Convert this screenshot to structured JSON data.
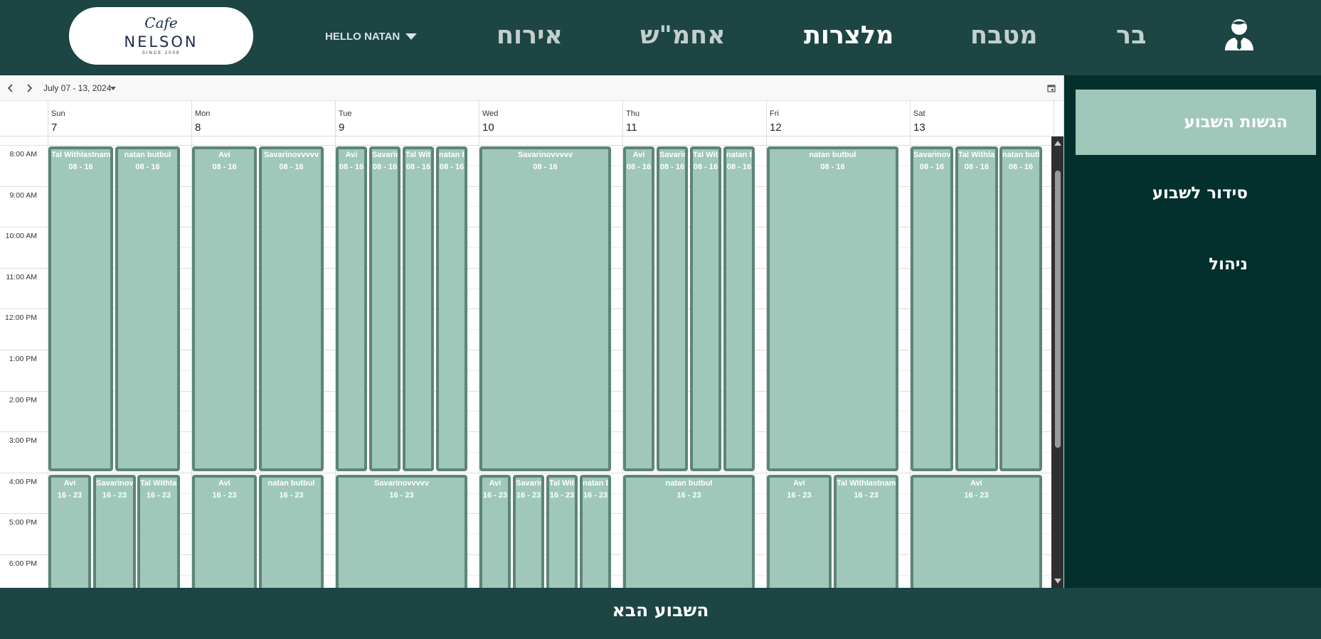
{
  "header": {
    "logo": {
      "script": "Cafe",
      "brand": "NELSON",
      "since": "SINCE 2009"
    },
    "user_greeting": "HELLO NATAN",
    "nav": [
      {
        "label": "אירוח",
        "active": false
      },
      {
        "label": "אחמ\"ש",
        "active": false
      },
      {
        "label": "מלצרות",
        "active": true
      },
      {
        "label": "מטבח",
        "active": false
      },
      {
        "label": "בר",
        "active": false
      }
    ]
  },
  "scheduler": {
    "range_label": "July 07 - 13, 2024",
    "days": [
      {
        "name": "Sun",
        "date": "7"
      },
      {
        "name": "Mon",
        "date": "8"
      },
      {
        "name": "Tue",
        "date": "9"
      },
      {
        "name": "Wed",
        "date": "10"
      },
      {
        "name": "Thu",
        "date": "11"
      },
      {
        "name": "Fri",
        "date": "12"
      },
      {
        "name": "Sat",
        "date": "13"
      }
    ],
    "time_labels": [
      "8:00 AM",
      "9:00 AM",
      "10:00 AM",
      "11:00 AM",
      "12:00 PM",
      "1:00 PM",
      "2:00 PM",
      "3:00 PM",
      "4:00 PM",
      "5:00 PM",
      "6:00 PM"
    ],
    "morning_shifts": [
      [
        "Tal Withlastname",
        "natan butbul"
      ],
      [
        "Avi",
        "Savarinovvvvv"
      ],
      [
        "Avi",
        "Savarinovvvvv",
        "Tal Withlastname",
        "natan butbul"
      ],
      [
        "Savarinovvvvv"
      ],
      [
        "Avi",
        "Savarinovvvvv",
        "Tal Withlastname",
        "natan butbul"
      ],
      [
        "natan butbul"
      ],
      [
        "Savarinovvvvv",
        "Tal Withlastname",
        "natan butbul"
      ]
    ],
    "evening_shifts": [
      [
        "Avi",
        "Savarinovvvvv",
        "Tal Withlastname"
      ],
      [
        "Avi",
        "natan butbul"
      ],
      [
        "Savarinovvvvv"
      ],
      [
        "Avi",
        "Savarinovvvvv",
        "Tal Withlastname",
        "natan butbul"
      ],
      [
        "natan butbul"
      ],
      [
        "Avi",
        "Tal Withlastname"
      ],
      [
        "Avi"
      ]
    ],
    "morning_time": "08 - 16",
    "evening_time": "16 - 23"
  },
  "sidebar": {
    "items": [
      {
        "label": "הגשות השבוע",
        "active": true
      },
      {
        "label": "סידור לשבוע",
        "active": false
      },
      {
        "label": "ניהול",
        "active": false
      }
    ]
  },
  "footer": {
    "next_week": "השבוע הבא"
  },
  "colors": {
    "header_bg": "#1c4543",
    "sidebar_bg": "#032f2d",
    "shift_fill": "#9fc8ba",
    "shift_border": "#5c8577"
  }
}
